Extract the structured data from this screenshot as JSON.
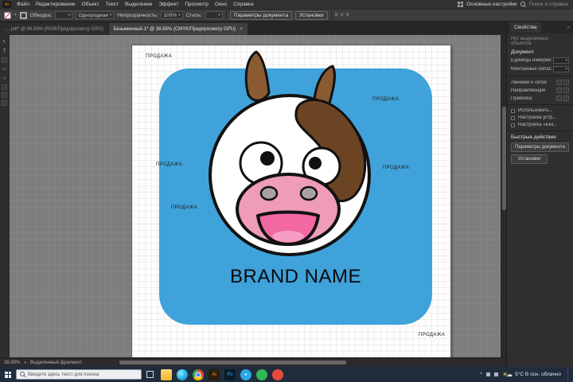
{
  "menubar": {
    "app_badge": "Ai",
    "items": [
      "Файл",
      "Редактирование",
      "Объект",
      "Текст",
      "Выделение",
      "Эффект",
      "Просмотр",
      "Окно",
      "Справка"
    ],
    "workspace": "Основные настройки",
    "search_placeholder": "Поиск и справка"
  },
  "controlbar": {
    "stroke_label": "Обводка:",
    "variable_width": "Однородная",
    "opacity_label": "Непрозрачность:",
    "opacity_value": "100%",
    "style_label": "Стиль:",
    "doc_setup_button": "Параметры документа",
    "preferences_button": "Установки",
    "align_glyphs": "≡ ≡ ≡"
  },
  "tabs": {
    "tab1": "….pdf* @ 96.89% (RGB/Предпросмотр GPU)",
    "tab2": "Безымянный-1* @ 38.89% (CMYK/Предпросмотр GPU)",
    "close": "×"
  },
  "artboard": {
    "brand_name": "BRAND NAME",
    "watermark": "ПРОДАЖА",
    "colors": {
      "card_blue": "#3fa2da",
      "horn_brown": "#8a5a33",
      "patch_brown": "#6b4423",
      "muzzle_pink": "#ef9cb9",
      "mouth_pink": "#f268a2",
      "nostril_gray": "#a9a2a4"
    }
  },
  "panel": {
    "tab": "Свойства",
    "menu_icon": "»",
    "no_selection": "Нет выделенных объектов",
    "section_document": "Документ",
    "row_units": "Единицы измерения",
    "row_artboards": "Монтажные области",
    "row_rulers": "Линейки и сетки",
    "row_guides": "Направляющие",
    "row_snap": "Привязка",
    "check1": "Использовать...",
    "check2": "Настройка устр...",
    "check3": "Настройка «Без...",
    "quick_actions": "Быстрые действия",
    "btn_doc_setup": "Параметры документа",
    "btn_preferences": "Установки",
    "caret": "▾"
  },
  "statusbar": {
    "zoom": "38.89%",
    "tool": "Выделенный фрагмент",
    "caret": "▾"
  },
  "taskbar": {
    "search_placeholder": "Введите здесь текст для поиска",
    "tray_chevron": "^",
    "weather": "5°C В осн. облачно",
    "tg_glyph": "➤",
    "ai_glyph": "Ai",
    "ps_glyph": "Ps"
  },
  "tools": {
    "selection": "↖",
    "type": "T",
    "rect": "▭",
    "ellipse": "○"
  }
}
